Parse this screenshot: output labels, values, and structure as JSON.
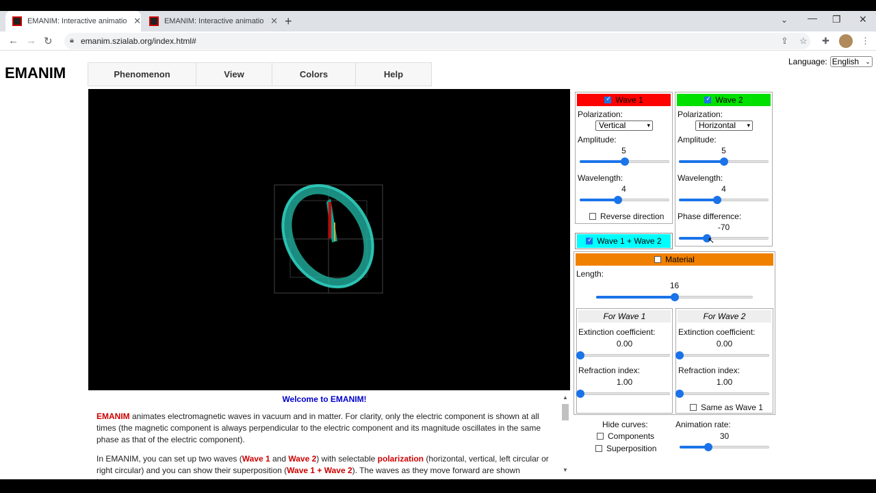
{
  "browser": {
    "tabs": [
      {
        "title": "EMANIM: Interactive animation o"
      },
      {
        "title": "EMANIM: Interactive animation o"
      }
    ],
    "url": "emanim.szialab.org/index.html#"
  },
  "site": {
    "logo": "EMANIM",
    "menu": [
      "Phenomenon",
      "View",
      "Colors",
      "Help"
    ],
    "language_label": "Language:",
    "language_value": "English"
  },
  "wave1": {
    "label": "Wave 1",
    "color": "#ff0000",
    "checked": true,
    "polarization_label": "Polarization:",
    "polarization": "Vertical",
    "amplitude_label": "Amplitude:",
    "amplitude": "5",
    "amplitude_level": 0.5,
    "wavelength_label": "Wavelength:",
    "wavelength": "4",
    "wavelength_level": 0.43,
    "reverse_label": "Reverse direction"
  },
  "wave2": {
    "label": "Wave 2",
    "color": "#00e000",
    "checked": true,
    "polarization_label": "Polarization:",
    "polarization": "Horizontal",
    "amplitude_label": "Amplitude:",
    "amplitude": "5",
    "amplitude_level": 0.5,
    "wavelength_label": "Wavelength:",
    "wavelength": "4",
    "wavelength_level": 0.43,
    "phase_label": "Phase difference:",
    "phase": "-70",
    "phase_level": 0.31
  },
  "superposition": {
    "label": "Wave 1 + Wave 2",
    "color": "#00ffff",
    "checked": true
  },
  "material": {
    "label": "Material",
    "color": "#f08000",
    "checked": false,
    "length_label": "Length:",
    "length": "16",
    "length_level": 0.5,
    "for_wave1": {
      "title": "For Wave 1",
      "extinction_label": "Extinction coefficient:",
      "extinction": "0.00",
      "refraction_label": "Refraction index:",
      "refraction": "1.00"
    },
    "for_wave2": {
      "title": "For Wave 2",
      "extinction_label": "Extinction coefficient:",
      "extinction": "0.00",
      "refraction_label": "Refraction index:",
      "refraction": "1.00",
      "same_label": "Same as Wave 1"
    }
  },
  "hide_curves": {
    "label": "Hide curves:",
    "components": "Components",
    "superposition": "Superposition"
  },
  "animation": {
    "label": "Animation rate:",
    "value": "30",
    "level": 0.32
  },
  "welcome": {
    "title": "Welcome to EMANIM!",
    "p1_name": "EMANIM",
    "p1_text": " animates electromagnetic waves in vacuum and in matter. For clarity, only the electric component is shown at all times (the magnetic component is always perpendicular to the electric component and its magnitude oscillates in the same phase as that of the electric component).",
    "p2_a": "In EMANIM, you can set up two waves (",
    "p2_w1": "Wave 1",
    "p2_b": " and ",
    "p2_w2": "Wave 2",
    "p2_c": ") with selectable ",
    "p2_pol": "polarization",
    "p2_d": " (horizontal, vertical, left circular or right circular) and you can show their superposition (",
    "p2_sum": "Wave 1 + Wave 2",
    "p2_e": "). The waves as they move forward are shown between"
  }
}
